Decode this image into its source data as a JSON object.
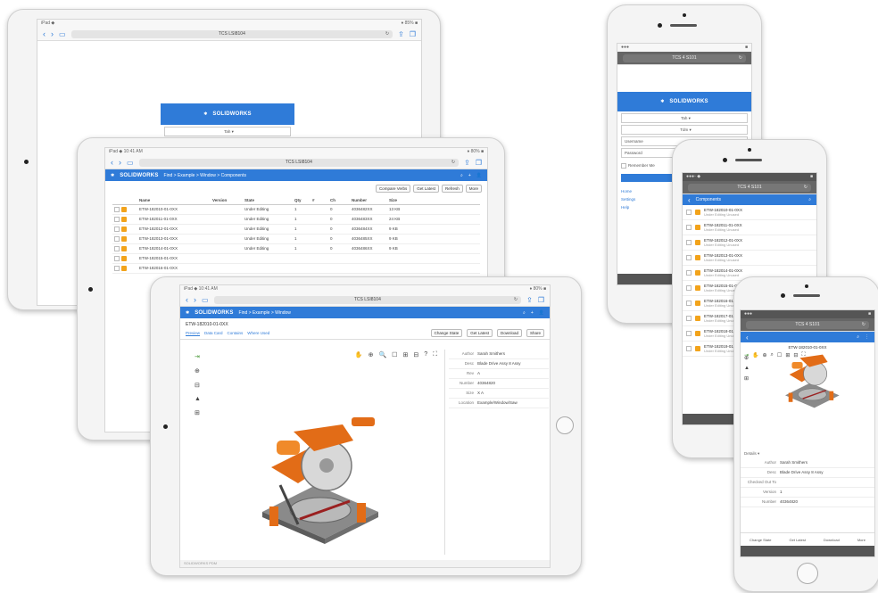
{
  "address_url": "TCS LSI8104",
  "address_url_phone": "TCS 4 S101",
  "reload_icon": "↻",
  "brand": {
    "logo": "SOLIDWORKS",
    "accent": "#2f7bd8"
  },
  "tablet_back": {
    "status_left": "iPad ◆",
    "status_right": "♦ 85% ■",
    "login_options": [
      "Tah",
      "Tdm"
    ]
  },
  "tablet_mid": {
    "status_left": "iPad ◆ 10:41 AM",
    "status_right": "♦ 80% ■",
    "breadcrumb": "Find > Example > Window > Components",
    "toolbar": [
      "Compare Verbs",
      "Get Latest",
      "Refresh",
      "More"
    ],
    "columns": [
      "Name",
      "Version",
      "State",
      "Qty",
      "#",
      "Ch",
      "Number",
      "Size"
    ],
    "rows": [
      [
        "ETW-182010-01-0XX",
        "",
        "Under Editing",
        "1",
        "",
        "0",
        "4036482XX",
        "13 KB"
      ],
      [
        "ETW-182011-01-0XX",
        "",
        "Under Editing",
        "1",
        "",
        "0",
        "4036483XX",
        "24 KB"
      ],
      [
        "ETW-182012-01-0XX",
        "",
        "Under Editing",
        "1",
        "",
        "0",
        "4036484XX",
        "9 KB"
      ],
      [
        "ETW-182013-01-0XX",
        "",
        "Under Editing",
        "1",
        "",
        "0",
        "4036485XX",
        "9 KB"
      ],
      [
        "ETW-182014-01-0XX",
        "",
        "Under Editing",
        "1",
        "",
        "0",
        "4036486XX",
        "9 KB"
      ],
      [
        "ETW-182015-01-0XX",
        "",
        "",
        "",
        "",
        "",
        "",
        ""
      ],
      [
        "ETW-182016-01-0XX",
        "",
        "",
        "",
        "",
        "",
        "",
        ""
      ]
    ]
  },
  "tablet_front": {
    "status_left": "iPad ◆ 10:41 AM",
    "status_right": "♦ 80% ■",
    "breadcrumb": "Find > Example > Window",
    "doc_title": "ETW-182010-01-0XX",
    "tabs": [
      "Preview",
      "Data Card",
      "Contains",
      "Where Used"
    ],
    "actions": [
      "Change State",
      "Get Latest",
      "Download",
      "Share"
    ],
    "viewer_tools": [
      "✋",
      "⊕",
      "🔍",
      "☐",
      "⊞",
      "⊟",
      "?",
      "⛶"
    ],
    "side_tools": [
      "⇥",
      "⊕",
      "⊟",
      "▲",
      "⊞"
    ],
    "properties": [
      {
        "k": "Author",
        "v": "Sarah Smithers"
      },
      {
        "k": "Desc",
        "v": "Blade Drive Assy 8 Assy"
      },
      {
        "k": "Rev",
        "v": "A"
      },
      {
        "k": "Number",
        "v": "40364820"
      },
      {
        "k": "Size",
        "v": "X A"
      },
      {
        "k": "Location",
        "v": "Example/Window/Saw"
      }
    ],
    "footer": "SOLIDWORKS PDM"
  },
  "phone_back": {
    "status_left": "●●●",
    "status_right": "■",
    "login_options": [
      "Tah",
      "Tdm"
    ],
    "username_placeholder": "Username",
    "password_placeholder": "Password",
    "remember": "Remember Me",
    "links": [
      "Home",
      "Settings",
      "Help"
    ]
  },
  "phone_mid": {
    "status_left": "●●●◦ ◆",
    "status_right": "■",
    "header": "Components",
    "items": [
      {
        "name": "ETW-182010-01-0XX",
        "desc": "Under Editing Unused"
      },
      {
        "name": "ETW-182011-01-0XX",
        "desc": "Under Editing Unused"
      },
      {
        "name": "ETW-182012-01-0XX",
        "desc": "Under Editing Unused"
      },
      {
        "name": "ETW-182013-01-0XX",
        "desc": "Under Editing Unused"
      },
      {
        "name": "ETW-182014-01-0XX",
        "desc": "Under Editing Unused"
      },
      {
        "name": "ETW-182015-01-0XX",
        "desc": "Under Editing Unused"
      },
      {
        "name": "ETW-182016-01-0XX",
        "desc": "Under Editing Unused"
      },
      {
        "name": "ETW-182017-01-0XX",
        "desc": "Under Editing Unused"
      },
      {
        "name": "ETW-182018-01-0XX",
        "desc": "Under Editing Unused"
      },
      {
        "name": "ETW-182019-01-0XX",
        "desc": "Under Editing Unused"
      }
    ]
  },
  "phone_front": {
    "status_left": "●●●",
    "status_right": "■",
    "doc_title": "ETW-182010-01-0XX",
    "details_label": "Details ▾",
    "properties": [
      {
        "k": "Author",
        "v": "Sarah Smithers"
      },
      {
        "k": "Desc",
        "v": "Blade Drive Assy 8 Assy"
      },
      {
        "k": "Checked Out To",
        "v": ""
      },
      {
        "k": "Version",
        "v": "1"
      },
      {
        "k": "Number",
        "v": "40364820"
      }
    ],
    "bottom_actions": [
      "Change State",
      "Get Latest",
      "Download",
      "More"
    ]
  }
}
